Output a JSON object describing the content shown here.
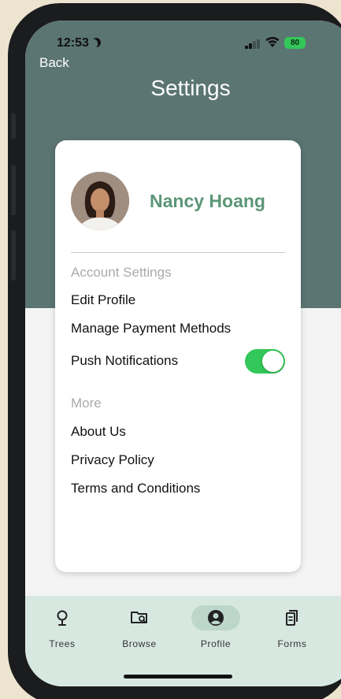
{
  "status_bar": {
    "time": "12:53",
    "battery": "80"
  },
  "header": {
    "back_label": "Back",
    "title": "Settings"
  },
  "profile": {
    "name": "Nancy Hoang"
  },
  "account_section": {
    "label": "Account Settings",
    "items": [
      "Edit Profile",
      "Manage Payment Methods",
      "Push Notifications"
    ],
    "push_notifications_enabled": true
  },
  "more_section": {
    "label": "More",
    "items": [
      "About Us",
      "Privacy Policy",
      "Terms and Conditions"
    ]
  },
  "tabs": [
    {
      "label": "Trees",
      "icon": "tree-icon",
      "active": false
    },
    {
      "label": "Browse",
      "icon": "folder-search-icon",
      "active": false
    },
    {
      "label": "Profile",
      "icon": "user-circle-icon",
      "active": true
    },
    {
      "label": "Forms",
      "icon": "document-icon",
      "active": false
    }
  ],
  "colors": {
    "header_bg": "#5b7572",
    "accent_green": "#5b9677",
    "toggle_on": "#34c759",
    "tab_bar_bg": "#d7e8e1"
  }
}
